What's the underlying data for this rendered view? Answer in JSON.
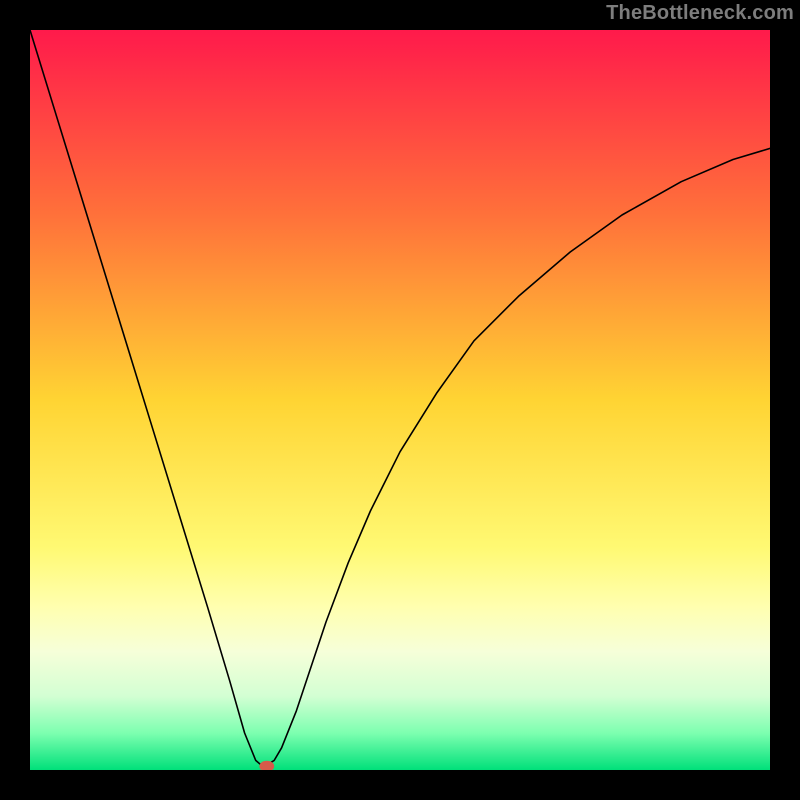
{
  "watermark": "TheBottleneck.com",
  "chart_data": {
    "type": "line",
    "title": "",
    "xlabel": "",
    "ylabel": "",
    "xlim": [
      0,
      100
    ],
    "ylim": [
      0,
      100
    ],
    "grid": false,
    "legend": false,
    "gradient_stops": [
      {
        "offset": 0,
        "color": "#ff1a4b"
      },
      {
        "offset": 25,
        "color": "#ff713a"
      },
      {
        "offset": 50,
        "color": "#ffd433"
      },
      {
        "offset": 70,
        "color": "#fff973"
      },
      {
        "offset": 78,
        "color": "#ffffb0"
      },
      {
        "offset": 84,
        "color": "#f6ffd9"
      },
      {
        "offset": 90,
        "color": "#d3ffd3"
      },
      {
        "offset": 95,
        "color": "#7dffb0"
      },
      {
        "offset": 100,
        "color": "#00e07a"
      }
    ],
    "curve": {
      "x": [
        0,
        4,
        8,
        12,
        16,
        20,
        24,
        27,
        29,
        30.5,
        31.2,
        32,
        33,
        34,
        36,
        38,
        40,
        43,
        46,
        50,
        55,
        60,
        66,
        73,
        80,
        88,
        95,
        100
      ],
      "y": [
        100,
        87,
        74,
        61,
        48,
        35,
        22,
        12,
        5,
        1.3,
        0.7,
        0.7,
        1.3,
        3,
        8,
        14,
        20,
        28,
        35,
        43,
        51,
        58,
        64,
        70,
        75,
        79.5,
        82.5,
        84
      ]
    },
    "min_marker": {
      "x": 32,
      "y": 0.5,
      "color": "#d65a4a",
      "radius": 1.0
    },
    "plateau": {
      "x0": 30.5,
      "x1": 33,
      "y": 0.7
    }
  }
}
